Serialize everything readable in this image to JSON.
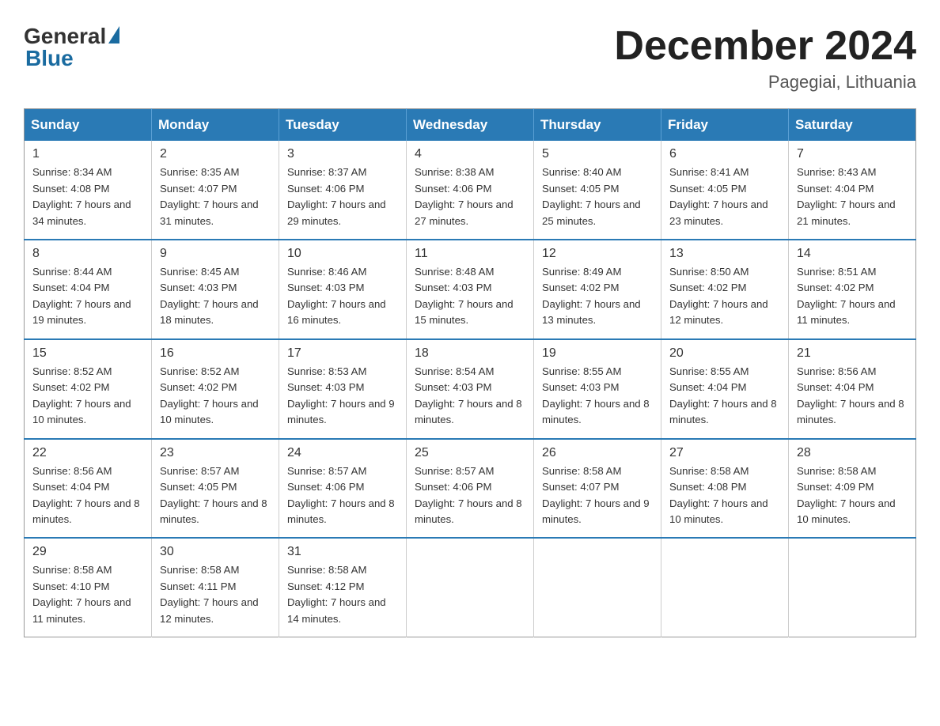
{
  "header": {
    "logo_general": "General",
    "logo_blue": "Blue",
    "month_title": "December 2024",
    "location": "Pagegiai, Lithuania"
  },
  "days_of_week": [
    "Sunday",
    "Monday",
    "Tuesday",
    "Wednesday",
    "Thursday",
    "Friday",
    "Saturday"
  ],
  "weeks": [
    [
      {
        "day": "1",
        "sunrise": "8:34 AM",
        "sunset": "4:08 PM",
        "daylight": "7 hours and 34 minutes."
      },
      {
        "day": "2",
        "sunrise": "8:35 AM",
        "sunset": "4:07 PM",
        "daylight": "7 hours and 31 minutes."
      },
      {
        "day": "3",
        "sunrise": "8:37 AM",
        "sunset": "4:06 PM",
        "daylight": "7 hours and 29 minutes."
      },
      {
        "day": "4",
        "sunrise": "8:38 AM",
        "sunset": "4:06 PM",
        "daylight": "7 hours and 27 minutes."
      },
      {
        "day": "5",
        "sunrise": "8:40 AM",
        "sunset": "4:05 PM",
        "daylight": "7 hours and 25 minutes."
      },
      {
        "day": "6",
        "sunrise": "8:41 AM",
        "sunset": "4:05 PM",
        "daylight": "7 hours and 23 minutes."
      },
      {
        "day": "7",
        "sunrise": "8:43 AM",
        "sunset": "4:04 PM",
        "daylight": "7 hours and 21 minutes."
      }
    ],
    [
      {
        "day": "8",
        "sunrise": "8:44 AM",
        "sunset": "4:04 PM",
        "daylight": "7 hours and 19 minutes."
      },
      {
        "day": "9",
        "sunrise": "8:45 AM",
        "sunset": "4:03 PM",
        "daylight": "7 hours and 18 minutes."
      },
      {
        "day": "10",
        "sunrise": "8:46 AM",
        "sunset": "4:03 PM",
        "daylight": "7 hours and 16 minutes."
      },
      {
        "day": "11",
        "sunrise": "8:48 AM",
        "sunset": "4:03 PM",
        "daylight": "7 hours and 15 minutes."
      },
      {
        "day": "12",
        "sunrise": "8:49 AM",
        "sunset": "4:02 PM",
        "daylight": "7 hours and 13 minutes."
      },
      {
        "day": "13",
        "sunrise": "8:50 AM",
        "sunset": "4:02 PM",
        "daylight": "7 hours and 12 minutes."
      },
      {
        "day": "14",
        "sunrise": "8:51 AM",
        "sunset": "4:02 PM",
        "daylight": "7 hours and 11 minutes."
      }
    ],
    [
      {
        "day": "15",
        "sunrise": "8:52 AM",
        "sunset": "4:02 PM",
        "daylight": "7 hours and 10 minutes."
      },
      {
        "day": "16",
        "sunrise": "8:52 AM",
        "sunset": "4:02 PM",
        "daylight": "7 hours and 10 minutes."
      },
      {
        "day": "17",
        "sunrise": "8:53 AM",
        "sunset": "4:03 PM",
        "daylight": "7 hours and 9 minutes."
      },
      {
        "day": "18",
        "sunrise": "8:54 AM",
        "sunset": "4:03 PM",
        "daylight": "7 hours and 8 minutes."
      },
      {
        "day": "19",
        "sunrise": "8:55 AM",
        "sunset": "4:03 PM",
        "daylight": "7 hours and 8 minutes."
      },
      {
        "day": "20",
        "sunrise": "8:55 AM",
        "sunset": "4:04 PM",
        "daylight": "7 hours and 8 minutes."
      },
      {
        "day": "21",
        "sunrise": "8:56 AM",
        "sunset": "4:04 PM",
        "daylight": "7 hours and 8 minutes."
      }
    ],
    [
      {
        "day": "22",
        "sunrise": "8:56 AM",
        "sunset": "4:04 PM",
        "daylight": "7 hours and 8 minutes."
      },
      {
        "day": "23",
        "sunrise": "8:57 AM",
        "sunset": "4:05 PM",
        "daylight": "7 hours and 8 minutes."
      },
      {
        "day": "24",
        "sunrise": "8:57 AM",
        "sunset": "4:06 PM",
        "daylight": "7 hours and 8 minutes."
      },
      {
        "day": "25",
        "sunrise": "8:57 AM",
        "sunset": "4:06 PM",
        "daylight": "7 hours and 8 minutes."
      },
      {
        "day": "26",
        "sunrise": "8:58 AM",
        "sunset": "4:07 PM",
        "daylight": "7 hours and 9 minutes."
      },
      {
        "day": "27",
        "sunrise": "8:58 AM",
        "sunset": "4:08 PM",
        "daylight": "7 hours and 10 minutes."
      },
      {
        "day": "28",
        "sunrise": "8:58 AM",
        "sunset": "4:09 PM",
        "daylight": "7 hours and 10 minutes."
      }
    ],
    [
      {
        "day": "29",
        "sunrise": "8:58 AM",
        "sunset": "4:10 PM",
        "daylight": "7 hours and 11 minutes."
      },
      {
        "day": "30",
        "sunrise": "8:58 AM",
        "sunset": "4:11 PM",
        "daylight": "7 hours and 12 minutes."
      },
      {
        "day": "31",
        "sunrise": "8:58 AM",
        "sunset": "4:12 PM",
        "daylight": "7 hours and 14 minutes."
      },
      null,
      null,
      null,
      null
    ]
  ]
}
